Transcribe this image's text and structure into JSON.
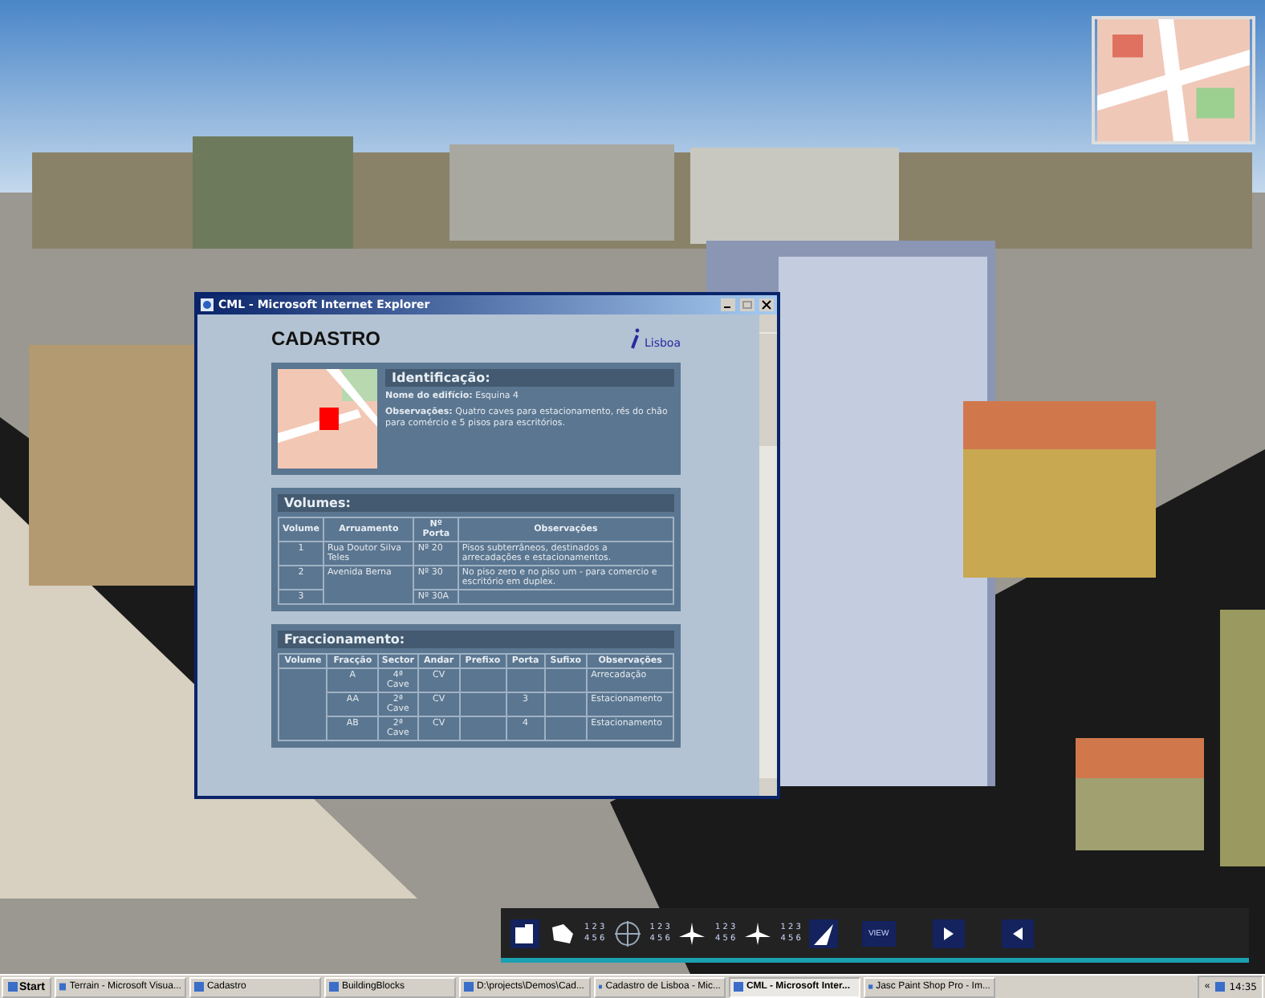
{
  "window": {
    "title": "CML - Microsoft Internet Explorer",
    "active": true
  },
  "page": {
    "heading": "CADASTRO",
    "logo_text": "Lisboa"
  },
  "identificacao": {
    "title": "Identificação:",
    "lines": [
      "**Nome do edifício:** Esquina 4",
      "**Observações:** Quatro caves para estacionamento, rés do chão para comércio e 5 pisos para escritórios."
    ]
  },
  "volumes": {
    "title": "Volumes:",
    "columns": [
      "Volume",
      "Arruamento",
      "Nº Porta",
      "Observações"
    ],
    "streets": [
      {
        "name": "Rua Doutor Silva Teles",
        "entries": [
          {
            "volume": "1",
            "porta": "Nº 20",
            "observacoes": "Pisos subterrâneos, destinados a arrecadações e estacionamentos."
          }
        ]
      },
      {
        "name": "Avenida Berna",
        "entries": [
          {
            "volume": "2",
            "porta": "Nº 30",
            "observacoes": "No piso zero e no piso um - para comercio e escritório em duplex."
          },
          {
            "volume": "3",
            "porta": "Nº 30A"
          }
        ]
      }
    ]
  },
  "fraccionamento": {
    "title": "Fraccionamento:",
    "columns": [
      "Volume",
      "Fracção",
      "Sector",
      "Andar",
      "Prefixo",
      "Porta",
      "Sufixo",
      "Observações"
    ],
    "rows": [
      {
        "fraccao": "A",
        "sector": "4ª Cave",
        "andar": "CV",
        "observacoes": "Arrecadação"
      },
      {
        "fraccao": "AA",
        "sector": "2ª Cave",
        "andar": "CV",
        "porta": "3",
        "observacoes": "Estacionamento"
      },
      {
        "fraccao": "AB",
        "sector": "2ª Cave",
        "andar": "CV",
        "porta": "4",
        "observacoes": "Estacionamento"
      }
    ]
  },
  "toolbar": {
    "pads": [
      {
        "top": "1 2 3",
        "bottom": "4 5 6"
      },
      {
        "top": "1 2 3",
        "bottom": "4 5 6"
      },
      {
        "top": "1 2 3",
        "bottom": "4 5 6"
      },
      {
        "top": "1 2 3",
        "bottom": "4 5 6"
      }
    ],
    "view_button": "VIEW"
  },
  "taskbar": {
    "start": "Start",
    "items": [
      {
        "label": "Terrain - Microsoft Visua...",
        "selected": false
      },
      {
        "label": "Cadastro",
        "selected": false
      },
      {
        "label": "BuildingBlocks",
        "selected": false
      },
      {
        "label": "D:\\projects\\Demos\\Cad...",
        "selected": false
      },
      {
        "label": "Cadastro de Lisboa - Mic...",
        "selected": false
      },
      {
        "label": "CML - Microsoft Inter...",
        "selected": true
      },
      {
        "label": "Jasc Paint Shop Pro - Im...",
        "selected": false
      }
    ],
    "tray_expand": "«",
    "time": "14:35"
  }
}
